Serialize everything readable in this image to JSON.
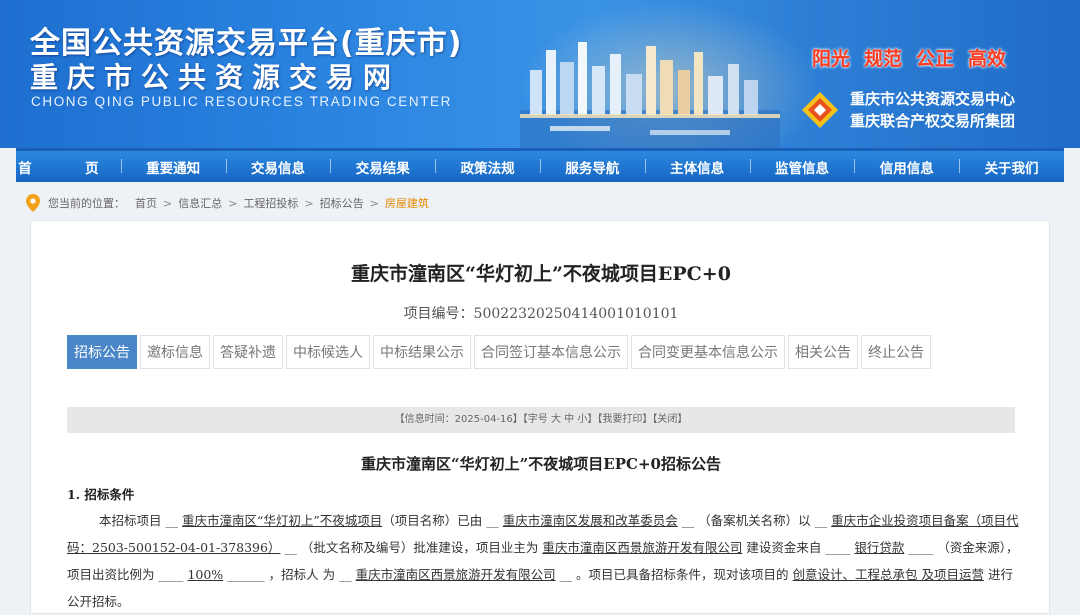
{
  "header": {
    "title_line1": "全国公共资源交易平台(重庆市)",
    "title_line2": "重庆市公共资源交易网",
    "title_en": "CHONG QING PUBLIC RESOURCES TRADING CENTER",
    "slogans": [
      "阳光",
      "规范",
      "公正",
      "高效"
    ],
    "org_name1": "重庆市公共资源交易中心",
    "org_name2": "重庆联合产权交易所集团"
  },
  "nav": [
    "首　页",
    "重要通知",
    "交易信息",
    "交易结果",
    "政策法规",
    "服务导航",
    "主体信息",
    "监管信息",
    "信用信息",
    "关于我们"
  ],
  "breadcrumb": {
    "prefix": "您当前的位置：",
    "items": [
      "首页",
      "信息汇总",
      "工程招投标",
      "招标公告",
      "房屋建筑"
    ]
  },
  "project": {
    "title": "重庆市潼南区“华灯初上”不夜城项目EPC+0",
    "code": "项目编号：50022320250414001010101"
  },
  "tabs": [
    "招标公告",
    "邀标信息",
    "答疑补遗",
    "中标候选人",
    "中标结果公示",
    "合同签订基本信息公示",
    "合同变更基本信息公示",
    "相关公告",
    "终止公告"
  ],
  "infobar": "【信息时间：2025-04-16】【字号 大 中 小】【我要打印】【关闭】",
  "notice": {
    "title": "重庆市潼南区“华灯初上”不夜城项目EPC+0招标公告",
    "section1": "1. 招标条件",
    "p1": {
      "t1": "本招标项目 __ ",
      "project_name": "重庆市潼南区“华灯初上”不夜城项目",
      "t2": "（项目名称）已由 __ ",
      "approver": "重庆市潼南区发展和改革委员会",
      "t3": " __ （备案机关名称）以 __ ",
      "approval_doc": "重庆市企业投资项目备案（项目代码：2503-500152-04-01-378396）",
      "t4": " __ （批文名称及编号）批准建设，项目业主为 ",
      "owner": "重庆市潼南区西景旅游开发有限公司",
      "t5": " 建设资金来自 ____ ",
      "fund_source": "银行贷款",
      "t6": " ____ （资金来源），项目出资比例为 ____ ",
      "ratio": "100%",
      "t7": " ______ ，招标人 为 __ ",
      "tenderer": "重庆市潼南区西景旅游开发有限公司",
      "t8": " __ 。项目已具备招标条件，现对该项目的 ",
      "scope": "创意设计、工程总承包 及项目运营",
      "t9": " 进行公开招标。"
    }
  },
  "colors": {
    "accent": "#4a86c8",
    "nav": "#1666c4",
    "slogan": "#ff3b1f",
    "crumb_active": "#e68a00"
  }
}
